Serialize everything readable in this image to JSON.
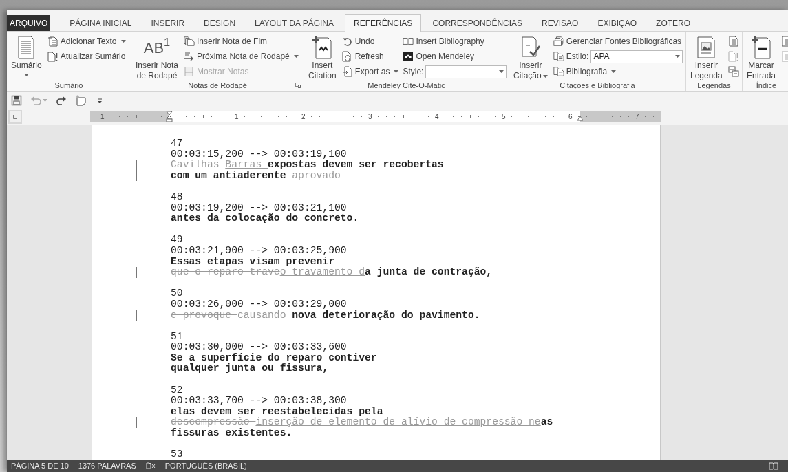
{
  "ribbon_tabs": [
    {
      "label": "ARQUIVO",
      "kind": "file",
      "selected": false
    },
    {
      "label": "PÁGINA INICIAL",
      "kind": "tab",
      "selected": false
    },
    {
      "label": "INSERIR",
      "kind": "tab",
      "selected": false
    },
    {
      "label": "DESIGN",
      "kind": "tab",
      "selected": false
    },
    {
      "label": "LAYOUT DA PÁGINA",
      "kind": "tab",
      "selected": false
    },
    {
      "label": "REFERÊNCIAS",
      "kind": "tab",
      "selected": true
    },
    {
      "label": "CORRESPONDÊNCIAS",
      "kind": "tab",
      "selected": false
    },
    {
      "label": "REVISÃO",
      "kind": "tab",
      "selected": false
    },
    {
      "label": "EXIBIÇÃO",
      "kind": "tab",
      "selected": false
    },
    {
      "label": "ZOTERO",
      "kind": "tab",
      "selected": false
    }
  ],
  "ribbon_groups": [
    {
      "label": "Sumário",
      "launcher": false,
      "columns": [
        [
          {
            "kind": "large",
            "label_lines": [
              "Sumário"
            ],
            "dropdown": true
          }
        ],
        [
          {
            "kind": "small",
            "label": "Adicionar Texto",
            "dropdown": true,
            "disabled": false
          },
          {
            "kind": "small",
            "label": "Atualizar Sumário",
            "dropdown": false,
            "disabled": false
          }
        ]
      ]
    },
    {
      "label": "Notas de Rodapé",
      "launcher": true,
      "columns": [
        [
          {
            "kind": "large",
            "glyph": "AB$^{1}$",
            "label_lines": [
              "Inserir Nota",
              "de Rodapé"
            ],
            "dropdown": false
          }
        ],
        [
          {
            "kind": "small",
            "label": "Inserir Nota de Fim",
            "dropdown": false,
            "disabled": false
          },
          {
            "kind": "small",
            "label": "Próxima Nota de Rodapé",
            "dropdown": true,
            "disabled": false
          },
          {
            "kind": "small",
            "label": "Mostrar Notas",
            "dropdown": false,
            "disabled": true
          }
        ]
      ]
    },
    {
      "label": "Mendeley Cite-O-Matic",
      "launcher": false,
      "columns": [
        [
          {
            "kind": "large",
            "label_lines": [
              "Insert",
              "Citation"
            ],
            "dropdown": false
          }
        ],
        [
          {
            "kind": "small",
            "label": "Undo",
            "dropdown": false,
            "disabled": false
          },
          {
            "kind": "small",
            "label": "Refresh",
            "dropdown": false,
            "disabled": false
          },
          {
            "kind": "small",
            "label": "Export as",
            "dropdown": true,
            "disabled": false
          }
        ],
        [
          {
            "kind": "small",
            "label": "Insert Bibliography",
            "dropdown": false,
            "disabled": false
          },
          {
            "kind": "small",
            "label": "Open Mendeley",
            "dropdown": false,
            "disabled": false
          },
          {
            "kind": "combo",
            "label": "Style:"
          }
        ]
      ]
    },
    {
      "label": "Citações e Bibliografia",
      "launcher": false,
      "columns": [
        [
          {
            "kind": "large",
            "label_lines": [
              "Inserir",
              "Citação"
            ],
            "dropdown": true
          }
        ],
        [
          {
            "kind": "small",
            "label": "Gerenciar Fontes Bibliográficas",
            "dropdown": false,
            "disabled": false
          },
          {
            "kind": "combo",
            "label": "Estilo:",
            "value": "APA"
          },
          {
            "kind": "small",
            "label": "Bibliografia",
            "dropdown": true,
            "disabled": false
          }
        ]
      ]
    },
    {
      "label": "Legendas",
      "launcher": false,
      "columns": [
        [
          {
            "kind": "large",
            "label_lines": [
              "Inserir",
              "Legenda"
            ],
            "dropdown": false
          }
        ],
        [
          {
            "kind": "icon",
            "disabled": false
          },
          {
            "kind": "icon",
            "disabled": true
          },
          {
            "kind": "icon",
            "disabled": false
          }
        ]
      ]
    },
    {
      "label": "Índice",
      "launcher": false,
      "columns": [
        [
          {
            "kind": "large",
            "label_lines": [
              "Marcar",
              "Entrada"
            ],
            "dropdown": false
          }
        ],
        [
          {
            "kind": "icon",
            "disabled": false
          },
          {
            "kind": "icon",
            "disabled": true
          }
        ]
      ]
    }
  ],
  "quick_access": [
    {
      "kind": "save",
      "disabled": false
    },
    {
      "kind": "undo",
      "disabled": true
    },
    {
      "kind": "redo",
      "disabled": false
    },
    {
      "kind": "comment",
      "disabled": false
    },
    {
      "kind": "customize",
      "disabled": false
    }
  ],
  "ruler": {
    "labels": [
      "1",
      "1",
      "2",
      "3",
      "4",
      "5",
      "6",
      "7"
    ]
  },
  "subtitles": [
    {
      "number": "47",
      "timing": "00:03:15,200 --> 00:03:19,100",
      "lines": [
        {
          "changed": true,
          "runs": [
            {
              "kind": "deleted",
              "text": "Cavilhas "
            },
            {
              "kind": "inserted",
              "text": "Barras "
            },
            {
              "kind": "normal",
              "text": "expostas devem ser recobertas"
            }
          ]
        },
        {
          "changed": true,
          "runs": [
            {
              "kind": "normal",
              "text": "com um antiaderente "
            },
            {
              "kind": "deleted",
              "text": "aprovado"
            }
          ]
        }
      ]
    },
    {
      "number": "48",
      "timing": "00:03:19,200 --> 00:03:21,100",
      "lines": [
        {
          "changed": false,
          "runs": [
            {
              "kind": "normal",
              "text": "antes da colocação do concreto."
            }
          ]
        }
      ]
    },
    {
      "number": "49",
      "timing": "00:03:21,900 --> 00:03:25,900",
      "lines": [
        {
          "changed": false,
          "runs": [
            {
              "kind": "normal",
              "text": "Essas etapas visam prevenir"
            }
          ]
        },
        {
          "changed": true,
          "runs": [
            {
              "kind": "deleted",
              "text": "que o reparo trave"
            },
            {
              "kind": "inserted",
              "text": "o travamento d"
            },
            {
              "kind": "normal",
              "text": "a junta de contração,"
            }
          ]
        }
      ]
    },
    {
      "number": "50",
      "timing": "00:03:26,000 --> 00:03:29,000",
      "lines": [
        {
          "changed": true,
          "runs": [
            {
              "kind": "deleted",
              "text": "e provoque "
            },
            {
              "kind": "inserted",
              "text": "causando "
            },
            {
              "kind": "normal",
              "text": "nova deterioração do pavimento."
            }
          ]
        }
      ]
    },
    {
      "number": "51",
      "timing": "00:03:30,000 --> 00:03:33,600",
      "lines": [
        {
          "changed": false,
          "runs": [
            {
              "kind": "normal",
              "text": "Se a superfície do reparo contiver"
            }
          ]
        },
        {
          "changed": false,
          "runs": [
            {
              "kind": "normal",
              "text": "qualquer junta ou fissura,"
            }
          ]
        }
      ]
    },
    {
      "number": "52",
      "timing": "00:03:33,700 --> 00:03:38,300",
      "lines": [
        {
          "changed": false,
          "runs": [
            {
              "kind": "normal",
              "text": "elas devem ser reestabelecidas pela"
            }
          ]
        },
        {
          "changed": true,
          "runs": [
            {
              "kind": "deleted",
              "text": "descompressão "
            },
            {
              "kind": "inserted",
              "text": "inserção de elemento de alívio de compressão ne"
            },
            {
              "kind": "normal",
              "text": "as"
            }
          ]
        },
        {
          "changed": false,
          "runs": [
            {
              "kind": "normal",
              "text": "fissuras existentes."
            }
          ]
        }
      ]
    },
    {
      "number": "53"
    }
  ],
  "status_bar": {
    "page": "PÁGINA 5 DE 10",
    "words": "1376 PALAVRAS",
    "language": "PORTUGUÊS (BRASIL)"
  }
}
